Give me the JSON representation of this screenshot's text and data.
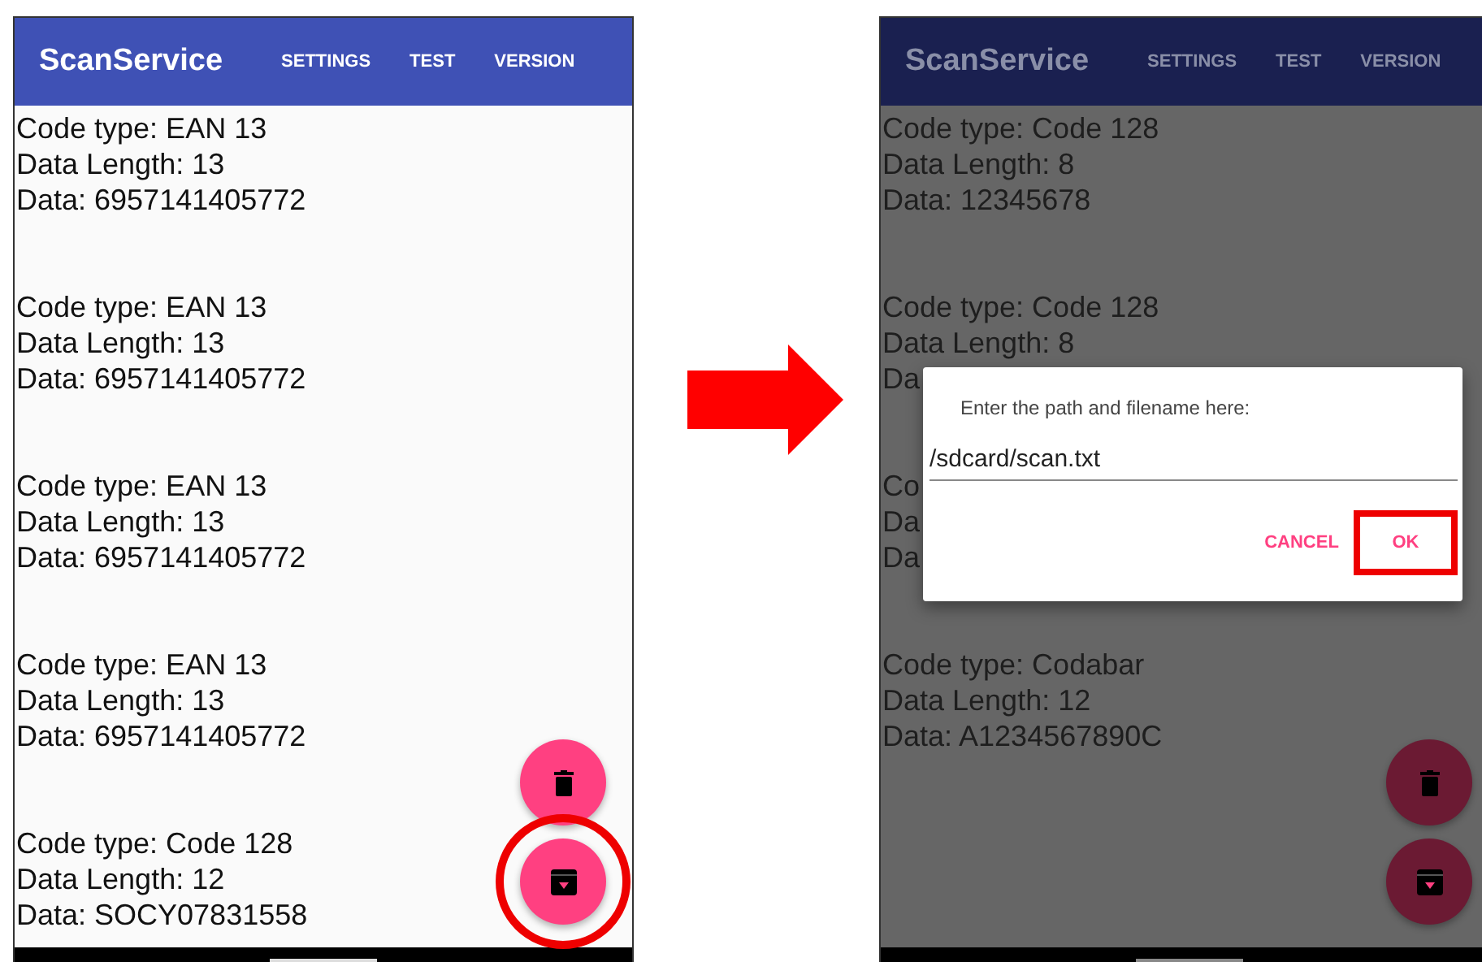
{
  "screens": [
    {
      "dimmed": false,
      "app_bar": {
        "title": "ScanService",
        "actions": [
          "SETTINGS",
          "TEST",
          "VERSION"
        ]
      },
      "entries": [
        {
          "lines": [
            "Code type: EAN 13",
            "Data Length: 13",
            "Data: 6957141405772"
          ]
        },
        {
          "lines": [
            "Code type: EAN 13",
            "Data Length: 13",
            "Data: 6957141405772"
          ]
        },
        {
          "lines": [
            "Code type: EAN 13",
            "Data Length: 13",
            "Data: 6957141405772"
          ]
        },
        {
          "lines": [
            "Code type: EAN 13",
            "Data Length: 13",
            "Data: 6957141405772"
          ]
        },
        {
          "lines": [
            "Code type: Code 128",
            "Data Length: 12",
            "Data: SOCY07831558"
          ]
        }
      ],
      "fabs": [
        {
          "kind": "delete",
          "highlighted": false
        },
        {
          "kind": "save",
          "highlighted": true
        }
      ]
    },
    {
      "dimmed": true,
      "app_bar": {
        "title": "ScanService",
        "actions": [
          "SETTINGS",
          "TEST",
          "VERSION"
        ]
      },
      "entries": [
        {
          "lines": [
            "Code type: Code 128",
            "Data Length: 8",
            "Data: 12345678"
          ]
        },
        {
          "lines": [
            "Code type: Code 128",
            "Data Length: 8",
            "Da"
          ]
        },
        {
          "lines": [
            "Co",
            "Da",
            "Da"
          ]
        },
        {
          "lines": [
            "Code type: Codabar",
            "Data Length: 12",
            "Data: A1234567890C"
          ]
        }
      ],
      "fabs": [
        {
          "kind": "delete",
          "highlighted": false
        },
        {
          "kind": "save",
          "highlighted": false
        }
      ],
      "dialog": {
        "title": "Enter the path and filename here:",
        "value": "/sdcard/scan.txt",
        "buttons": [
          {
            "label": "CANCEL",
            "highlighted": false
          },
          {
            "label": "OK",
            "highlighted": true
          }
        ]
      }
    }
  ]
}
